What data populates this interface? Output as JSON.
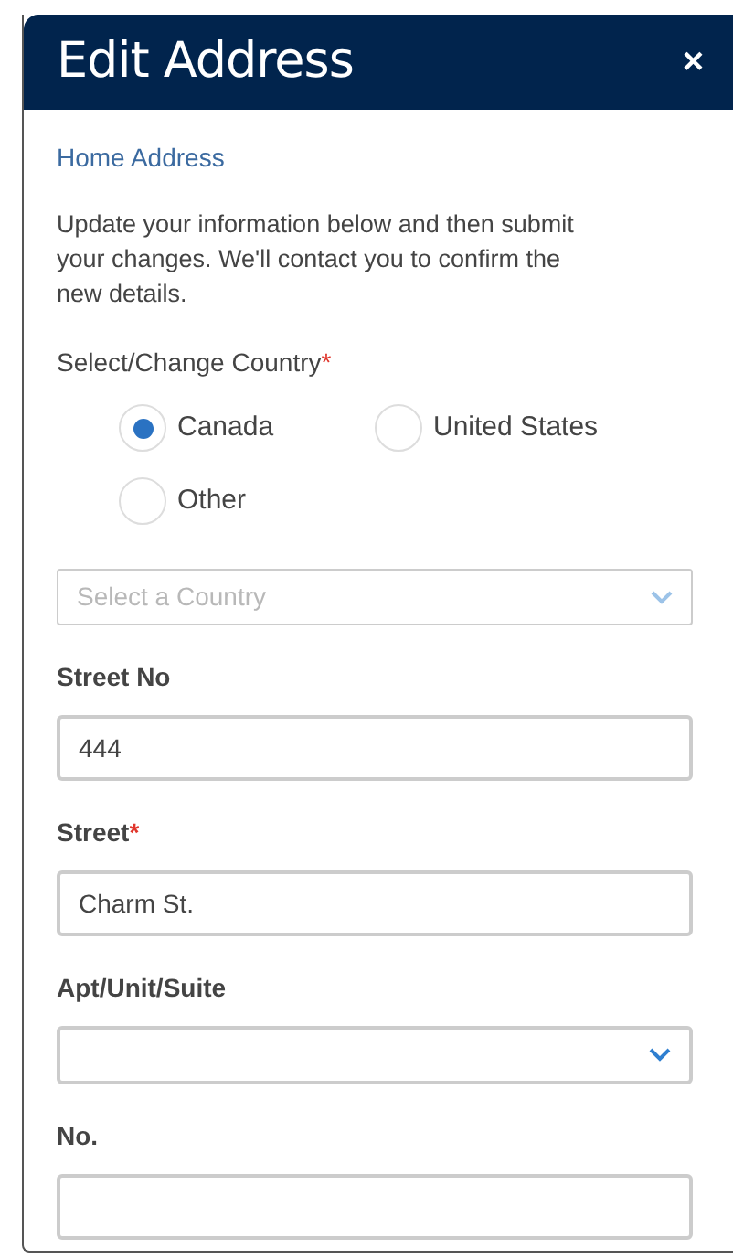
{
  "dialog": {
    "title": "Edit Address",
    "close": "×"
  },
  "section": "Home Address",
  "intro": "Update your information below and then submit your changes. We'll contact you to confirm the new details.",
  "country": {
    "label": "Select/Change Country",
    "required_mark": "*",
    "options": [
      {
        "label": "Canada",
        "selected": true
      },
      {
        "label": "United States",
        "selected": false
      },
      {
        "label": "Other",
        "selected": false
      }
    ],
    "select": {
      "placeholder": "Select a Country",
      "disabled": true
    }
  },
  "fields": [
    {
      "kind": "text",
      "label": "Street No",
      "value": "444"
    },
    {
      "kind": "text",
      "label": "Street",
      "required_mark": "*",
      "value": "Charm St."
    },
    {
      "kind": "select",
      "label": "Apt/Unit/Suite"
    },
    {
      "kind": "text",
      "label": "No."
    }
  ]
}
